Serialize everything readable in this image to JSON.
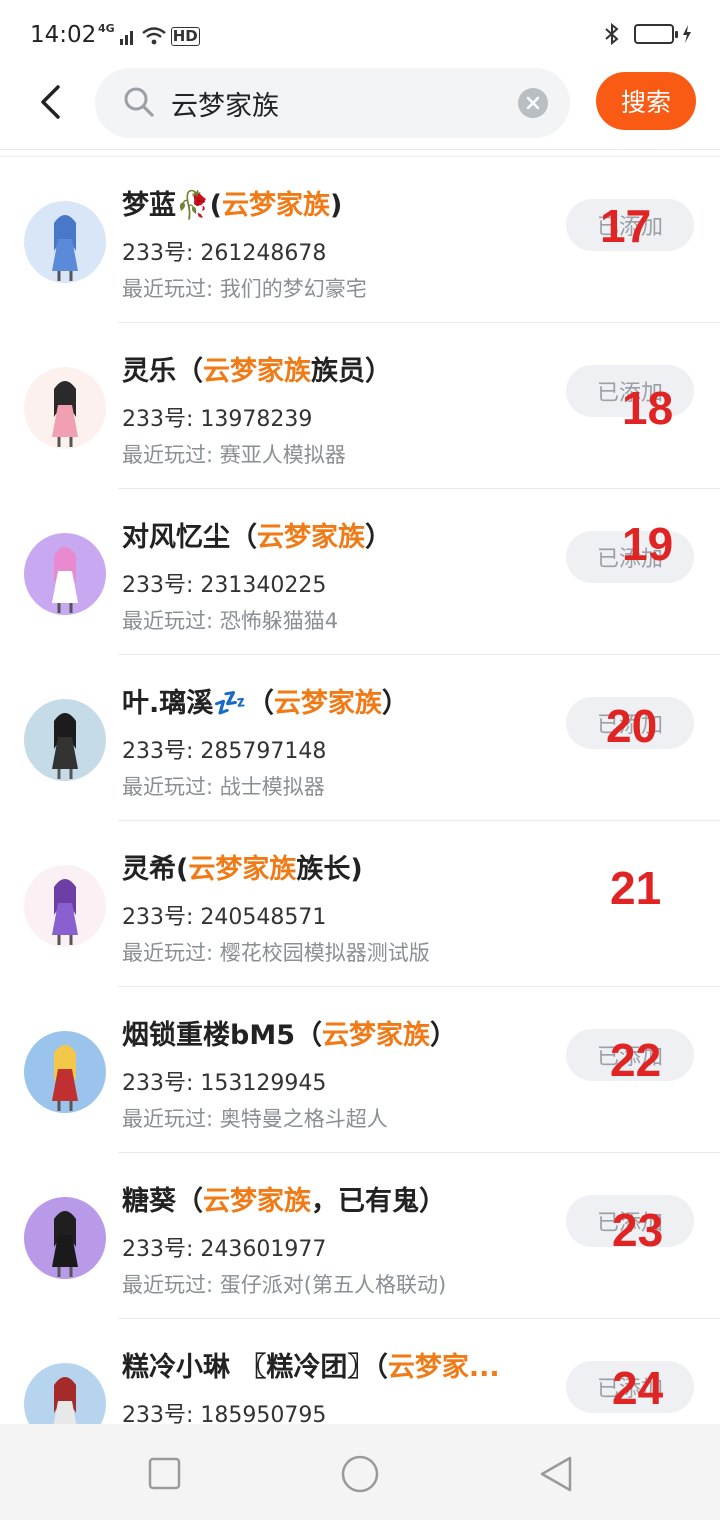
{
  "status_bar": {
    "time": "14:02",
    "network": "4G",
    "hd": "HD"
  },
  "header": {
    "search_value": "云梦家族",
    "search_button": "搜索"
  },
  "labels": {
    "id_prefix": "233号: ",
    "played_prefix": "最近玩过: ",
    "added": "已添加"
  },
  "results": [
    {
      "name_pre": "梦蓝🥀(",
      "name_hl": "云梦家族",
      "name_post": ")",
      "id": "261248678",
      "played": "我们的梦幻豪宅",
      "num": "17",
      "has_button": true,
      "avatar_color": "#d9e6f7"
    },
    {
      "name_pre": "灵乐（",
      "name_hl": "云梦家族",
      "name_post": "族员）",
      "id": "13978239",
      "played": "赛亚人模拟器",
      "num": "18",
      "has_button": true,
      "avatar_color": "#fdf1ef"
    },
    {
      "name_pre": "对风忆尘（",
      "name_hl": "云梦家族",
      "name_post": "）",
      "id": "231340225",
      "played": "恐怖躲猫猫4",
      "num": "19",
      "has_button": true,
      "avatar_color": "#c8a8f0"
    },
    {
      "name_pre": "叶.璃溪💤（",
      "name_hl": "云梦家族",
      "name_post": "）",
      "id": "285797148",
      "played": "战士模拟器",
      "num": "20",
      "has_button": true,
      "avatar_color": "#c6dbe8"
    },
    {
      "name_pre": "灵希(",
      "name_hl": "云梦家族",
      "name_post": "族长)",
      "id": "240548571",
      "played": "樱花校园模拟器测试版",
      "num": "21",
      "has_button": false,
      "avatar_color": "#fbf1f4"
    },
    {
      "name_pre": "烟锁重楼bM5（",
      "name_hl": "云梦家族",
      "name_post": "）",
      "id": "153129945",
      "played": "奥特曼之格斗超人",
      "num": "22",
      "has_button": true,
      "avatar_color": "#9bc4ec"
    },
    {
      "name_pre": "糖葵（",
      "name_hl": "云梦家族",
      "name_post": "，已有鬼）",
      "id": "243601977",
      "played": "蛋仔派对(第五人格联动)",
      "num": "23",
      "has_button": true,
      "avatar_color": "#b89ae8"
    },
    {
      "name_pre": "糕冷小琳 〖糕冷团〗（",
      "name_hl": "云梦家...",
      "name_post": "",
      "id": "185950795",
      "played": "",
      "num": "24",
      "has_button": true,
      "avatar_color": "#b7d4ee"
    }
  ],
  "colors": {
    "accent": "#fa5b14",
    "highlight": "#f07a16",
    "annotation": "#e02424"
  }
}
